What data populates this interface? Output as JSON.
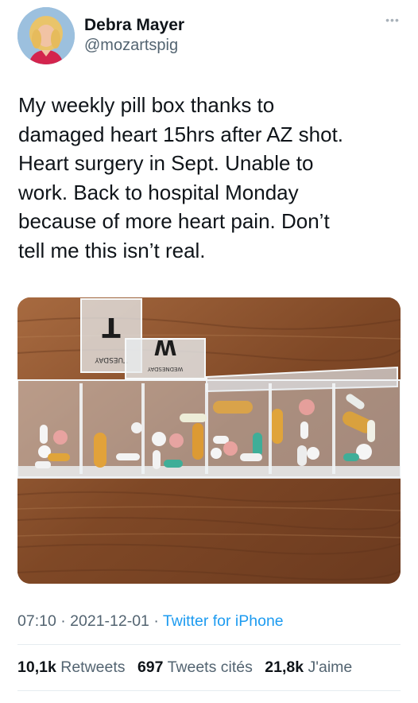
{
  "author": {
    "display_name": "Debra Mayer",
    "handle": "@mozartspig"
  },
  "more_menu": "•••",
  "tweet": {
    "text": "My weekly pill box thanks to\ndamaged heart 15hrs after AZ shot.\nHeart surgery in Sept. Unable to\nwork. Back to hospital Monday\nbecause of more heart pain. Don’t\ntell me this isn’t real."
  },
  "photo": {
    "box_labels": [
      "TUESDAY",
      "WEDNESDAY"
    ],
    "lid_letters": [
      "T",
      "W"
    ]
  },
  "meta": {
    "time": "07:10",
    "date": "2021-12-01",
    "separator": "·",
    "source": "Twitter for iPhone"
  },
  "stats": {
    "retweets_count": "10,1k",
    "retweets_label": "Retweets",
    "quotes_count": "697",
    "quotes_label": "Tweets cités",
    "likes_count": "21,8k",
    "likes_label": "J'aime"
  },
  "colors": {
    "link": "#1d9bf0",
    "secondary_text": "#536471",
    "primary_text": "#0f1419",
    "divider": "#e6ecf0"
  }
}
